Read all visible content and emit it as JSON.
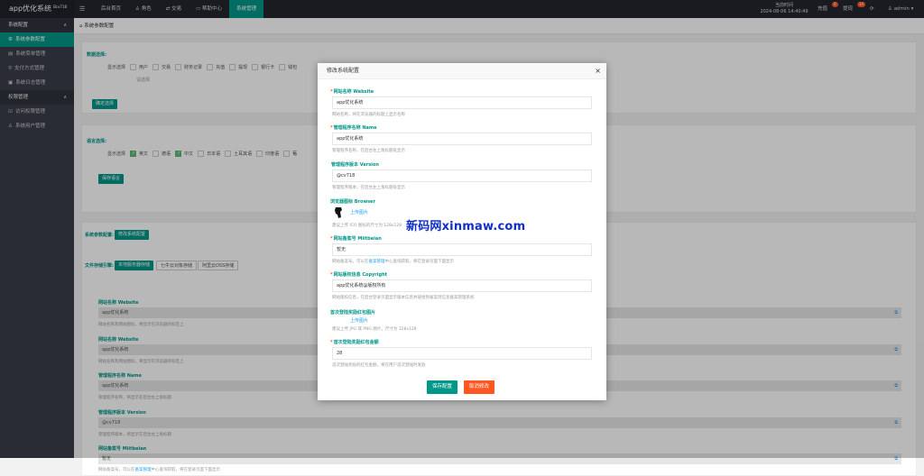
{
  "app": {
    "title": "app优化系统",
    "version": "Bcv718"
  },
  "topnav": [
    "后台首页",
    "角色",
    "交易",
    "帮助中心",
    "系统管理"
  ],
  "topright": {
    "time_label": "当前时间",
    "time_value": "2024-08-06 14:40:49",
    "recharge": "充值",
    "recharge_badge": "0",
    "withdraw": "提现",
    "withdraw_badge": "34",
    "user": "admin"
  },
  "sidebar": {
    "group1": "系统配置",
    "items1": [
      "系统参数配置",
      "系统菜单管理",
      "支付方式管理",
      "系统日志管理"
    ],
    "group2": "权限管理",
    "items2": [
      "访问权限管理",
      "系统用户管理"
    ]
  },
  "breadcrumb": "系统参数配置",
  "bg": {
    "data_select_label": "数据选择:",
    "display_label": "显示选择",
    "checkboxes": [
      "用户",
      "交易",
      "财务记录",
      "充值",
      "提现",
      "银行卡",
      "钱包"
    ],
    "select_placeholder": "请选择",
    "confirm_btn": "确定选择",
    "lang_label": "语言选择:",
    "lang_display": "显示选择",
    "langs": [
      "英文",
      "德语",
      "中文",
      "日本语",
      "土耳其语",
      "印度语",
      "葡"
    ],
    "save_lang_btn": "保存语言",
    "sysparam_label": "系统参数配置:",
    "sysparam_btn": "修改系统配置",
    "storage_label": "文件存储引擎:",
    "storage_btns": [
      "本地服务器存储",
      "七牛云对象存储",
      "阿里云OSS存储"
    ],
    "fields": [
      {
        "label": "网站名称 Website",
        "value": "app优化系统",
        "hint": "网站名称及网站图标，将显示在浏览器的标签上"
      },
      {
        "label": "网站名称 Website",
        "value": "app优化系统",
        "hint": "网站名称及网站图标，将显示在浏览器的标签上"
      },
      {
        "label": "管理程序名称 Name",
        "value": "app优化系统",
        "hint": "管理程序名称，将显示在后台左上角标题"
      },
      {
        "label": "管理程序版本 Version",
        "value": "@cv718",
        "hint": "管理程序版本，将显示在后台左上角标题"
      },
      {
        "label": "网站备案号 Miitbeian",
        "value": "暂无",
        "hint_pre": "网站备案号，可以在",
        "hint_link": "备案管理",
        "hint_post": "中心查询获取，将在登录页面下面显示"
      }
    ]
  },
  "modal": {
    "title": "修改系统配置",
    "fields": [
      {
        "label": "网站名称 Website",
        "value": "app优化系统",
        "hint": "网站名称，将在浏览器的标题上显示名称",
        "req": "*"
      },
      {
        "label": "管理程序名称 Name",
        "value": "app优化系统",
        "hint": "管理程序名称，在后台左上角标题处显示",
        "req": "*"
      },
      {
        "label": "管理程序版本 Version",
        "value": "@cv718",
        "hint": "管理程序版本，在后台左上角标题处显示",
        "req": ""
      }
    ],
    "browser_icon_label": "浏览器图标 Browser",
    "upload_text": "上传图片",
    "browser_icon_hint": "建议上传 ICO 图标的尺寸为 128x128",
    "beian": {
      "label": "网站备案号 Miitbeian",
      "value": "暂无",
      "hint_pre": "网站备案号，可以在",
      "hint_link": "备案管理",
      "hint_post": "中心查询获取，将在登录页面下面显示",
      "req": "*"
    },
    "copyright": {
      "label": "网站版权信息 Copyright",
      "value": "app优化系统@版权所有",
      "hint": "网站版权信息，在后台登录页面显示版本信息并链接到备案到信息备案管理系统",
      "req": "*"
    },
    "redpack_label": "首次登陆奖励红包图片",
    "redpack_upload": "上传图片",
    "redpack_hint": "建议上传 JPG 或 PNG 图片，尺寸为 128x128",
    "amount": {
      "label": "首次登陆奖励红包金额",
      "value": "28",
      "hint": "首次登陆奖励的红包金额，将在用户首次登陆时发放",
      "req": "*"
    },
    "save_btn": "保存配置",
    "cancel_btn": "取消修改"
  },
  "watermark": "新码网xinmaw.com",
  "colors": {
    "accent": "#009688",
    "topbar": "#23262e",
    "sidebar": "#393d49",
    "danger": "#ff5722"
  }
}
